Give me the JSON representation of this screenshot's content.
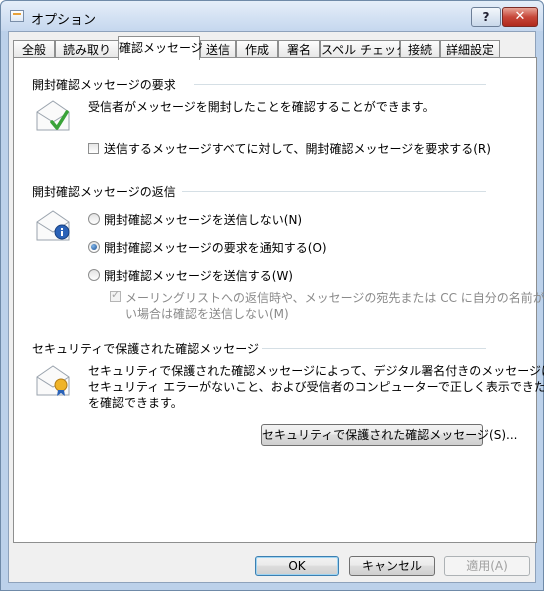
{
  "window": {
    "title": "オプション",
    "help_label": "?",
    "close_label": "✕"
  },
  "tabs": [
    {
      "label": "全般"
    },
    {
      "label": "読み取り"
    },
    {
      "label": "確認メッセージ"
    },
    {
      "label": "送信"
    },
    {
      "label": "作成"
    },
    {
      "label": "署名"
    },
    {
      "label": "スペル チェック"
    },
    {
      "label": "接続"
    },
    {
      "label": "詳細設定"
    }
  ],
  "request_section": {
    "title": "開封確認メッセージの要求",
    "description": "受信者がメッセージを開封したことを確認することができます。",
    "checkbox_label": "送信するメッセージすべてに対して、開封確認メッセージを要求する(R)",
    "checkbox_checked": false,
    "icon": "envelope-check-icon"
  },
  "reply_section": {
    "title": "開封確認メッセージの返信",
    "radio_never": "開封確認メッセージを送信しない(N)",
    "radio_notify": "開封確認メッセージの要求を通知する(O)",
    "radio_always": "開封確認メッセージを送信する(W)",
    "selected": "radio_notify",
    "sub_checkbox_line1": "メーリングリストへの返信時や、メッセージの宛先または CC に自分の名前がな",
    "sub_checkbox_line2": "い場合は確認を送信しない(M)",
    "icon": "envelope-info-icon"
  },
  "secure_section": {
    "title": "セキュリティで保護された確認メッセージ",
    "line1": "セキュリティで保護された確認メッセージによって、デジタル署名付きのメッセージに",
    "line2": "セキュリティ エラーがないこと、および受信者のコンピューターで正しく表示できたこと",
    "line3": "を確認できます。",
    "button_label": "セキュリティで保護された確認メッセージ(S)...",
    "icon": "envelope-secure-icon"
  },
  "footer": {
    "ok_label": "OK",
    "cancel_label": "キャンセル",
    "apply_label": "適用(A)"
  },
  "colors": {
    "accent": "#3c7fb1",
    "window_frame": "#bcd1ea"
  }
}
